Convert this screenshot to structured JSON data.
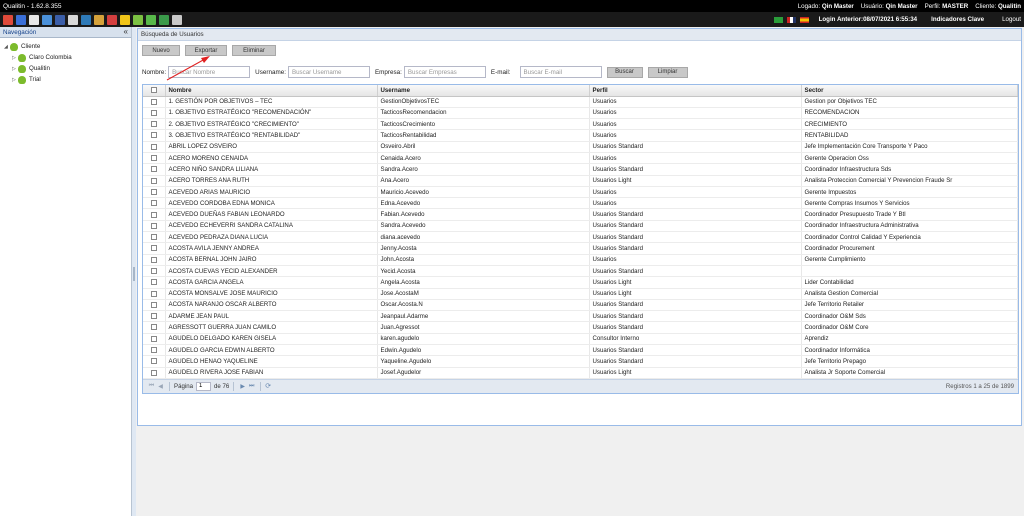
{
  "app": {
    "title": "Qualitin - 1.62.8.355",
    "logado_label": "Logado:",
    "logado_value": "Qin Master",
    "usuario_label": "Usuário:",
    "usuario_value": "Qin Master",
    "perfil_label": "Perfil:",
    "perfil_value": "MASTER",
    "cliente_label": "Cliente:",
    "cliente_value": "Qualitin"
  },
  "toolbar": {
    "last_login": "Login Anterior:08/07/2021 6:55:34",
    "indicadores": "Indicadores Clave",
    "logout": "Logout",
    "icon_colors": [
      "#e04a3a",
      "#3a6fd8",
      "#e8e8e8",
      "#4a90d9",
      "#3b5ea8",
      "#d9d9d9",
      "#2e7ab8",
      "#d6a23a",
      "#d43f3f",
      "#f0c419",
      "#7cc142",
      "#58b94a",
      "#3a9a4a",
      "#c9c9c9"
    ]
  },
  "sidebar": {
    "title": "Navegación",
    "root": "Cliente",
    "children": [
      "Claro Colombia",
      "Qualitin",
      "Trial"
    ]
  },
  "panel": {
    "title": "Búsqueda de Usuarios",
    "buttons": {
      "nuevo": "Nuevo",
      "exportar": "Exportar",
      "eliminar": "Eliminar"
    }
  },
  "filters": {
    "nombre_label": "Nombre:",
    "nombre_placeholder": "Buscar Nombre",
    "username_label": "Username:",
    "username_placeholder": "Buscar Username",
    "empresa_label": "Empresa:",
    "empresa_placeholder": "Buscar Empresas",
    "email_label": "E-mail:",
    "email_placeholder": "Buscar E-mail",
    "buscar": "Buscar",
    "limpiar": "Limpiar"
  },
  "grid": {
    "columns": [
      "Nombre",
      "Username",
      "Perfil",
      "Sector"
    ],
    "rows": [
      [
        "1. GESTIÓN POR OBJETIVOS – TEC",
        "GestionObjetivosTEC",
        "Usuarios",
        "Gestion por Objetivos TEC"
      ],
      [
        "1. OBJETIVO ESTRATÉGICO \"RECOMENDACIÓN\"",
        "TacticosRecomendacion",
        "Usuarios",
        "RECOMENDACION"
      ],
      [
        "2. OBJETIVO ESTRATÉGICO \"CRECIMIENTO\"",
        "TacticosCrecimiento",
        "Usuarios",
        "CRECIMIENTO"
      ],
      [
        "3. OBJETIVO ESTRATÉGICO \"RENTABILIDAD\"",
        "TacticosRentabilidad",
        "Usuarios",
        "RENTABILIDAD"
      ],
      [
        "ABRIL LOPEZ OSVEIRO",
        "Osveiro.Abril",
        "Usuarios Standard",
        "Jefe Implementación Core Transporte Y Paco"
      ],
      [
        "ACERO MORENO CENAIDA",
        "Cenaida.Acero",
        "Usuarios",
        "Gerente Operacion Oss"
      ],
      [
        "ACERO NIÑO SANDRA LILIANA",
        "Sandra.Acero",
        "Usuarios Standard",
        "Coordinador Infraestructura Sds"
      ],
      [
        "ACERO TORRES ANA RUTH",
        "Ana.Acero",
        "Usuarios Light",
        "Analista Proteccion Comercial Y Prevencion Fraude Sr"
      ],
      [
        "ACEVEDO ARIAS MAURICIO",
        "Mauricio.Acevedo",
        "Usuarios",
        "Gerente Impuestos"
      ],
      [
        "ACEVEDO CORDOBA EDNA MONICA",
        "Edna.Acevedo",
        "Usuarios",
        "Gerente Compras Insumos Y Servicios"
      ],
      [
        "ACEVEDO DUEÑAS FABIAN LEONARDO",
        "Fabian.Acevedo",
        "Usuarios Standard",
        "Coordinador Presupuesto Trade Y Btl"
      ],
      [
        "ACEVEDO ECHEVERRI SANDRA CATALINA",
        "Sandra.Acevedo",
        "Usuarios Standard",
        "Coordinador Infraestructura Administrativa"
      ],
      [
        "ACEVEDO PEDRAZA DIANA LUCIA",
        "diana.acevedo",
        "Usuarios Standard",
        "Coordinador Control Calidad Y Experiencia"
      ],
      [
        "ACOSTA AVILA JENNY ANDREA",
        "Jenny.Acosta",
        "Usuarios Standard",
        "Coordinador Procurement"
      ],
      [
        "ACOSTA BERNAL JOHN JAIRO",
        "John.Acosta",
        "Usuarios",
        "Gerente Cumplimiento"
      ],
      [
        "ACOSTA CUEVAS YECID ALEXANDER",
        "Yecid.Acosta",
        "Usuarios Standard",
        ""
      ],
      [
        "ACOSTA GARCIA ANGELA",
        "Angela.Acosta",
        "Usuarios Light",
        "Lider Contabilidad"
      ],
      [
        "ACOSTA MONSALVE JOSE MAURICIO",
        "Jose.AcostaM",
        "Usuarios Light",
        "Analista Gestion Comercial"
      ],
      [
        "ACOSTA NARANJO OSCAR ALBERTO",
        "Oscar.Acosta.N",
        "Usuarios Standard",
        "Jefe Territorio Retailer"
      ],
      [
        "ADARME JEAN PAUL",
        "Jeanpaul.Adarme",
        "Usuarios Standard",
        "Coordinador O&M Sds"
      ],
      [
        "AGRESSOTT GUERRA JUAN CAMILO",
        "Juan.Agressot",
        "Usuarios Standard",
        "Coordinador O&M Core"
      ],
      [
        "AGUDELO DELGADO KAREN GISELA",
        "karen.agudelo",
        "Consultor Interno",
        "Aprendiz"
      ],
      [
        "AGUDELO GARCIA EDWIN ALBERTO",
        "Edwin.Agudelo",
        "Usuarios Standard",
        "Coordinador Informática"
      ],
      [
        "AGUDELO HENAO YAQUELINE",
        "Yaqueline.Agudelo",
        "Usuarios Standard",
        "Jefe Territorio Prepago"
      ],
      [
        "AGUDELO RIVERA JOSE FABIAN",
        "Josef.Agudelor",
        "Usuarios Light",
        "Analista Jr Soporte Comercial"
      ]
    ]
  },
  "pager": {
    "page_label": "Página",
    "page_value": "1",
    "of_label": "de 76",
    "summary": "Registros 1 a 25 de 1899"
  }
}
